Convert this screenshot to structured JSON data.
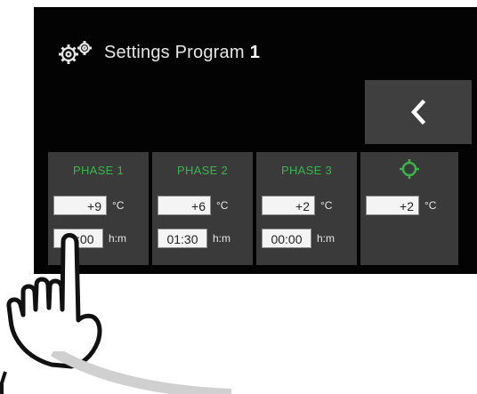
{
  "header": {
    "title": "Settings Program",
    "program_number": "1",
    "icon": "gears-icon"
  },
  "back_button": {
    "icon": "chevron-left-icon"
  },
  "phases": [
    {
      "label": "PHASE 1",
      "temp": "+9",
      "temp_unit": "°C",
      "time": "05:00",
      "time_unit": "h:m"
    },
    {
      "label": "PHASE 2",
      "temp": "+6",
      "temp_unit": "°C",
      "time": "01:30",
      "time_unit": "h:m"
    },
    {
      "label": "PHASE 3",
      "temp": "+2",
      "temp_unit": "°C",
      "time": "00:00",
      "time_unit": "h:m"
    }
  ],
  "hold_phase": {
    "icon": "target-icon",
    "temp": "+2",
    "temp_unit": "°C"
  },
  "overlay": {
    "hand": "pointing-hand-icon"
  },
  "colors": {
    "screen_bg": "#030303",
    "card_bg": "#3a3a3a",
    "accent_green": "#39b54a",
    "back_bg": "#3f3f3f"
  }
}
